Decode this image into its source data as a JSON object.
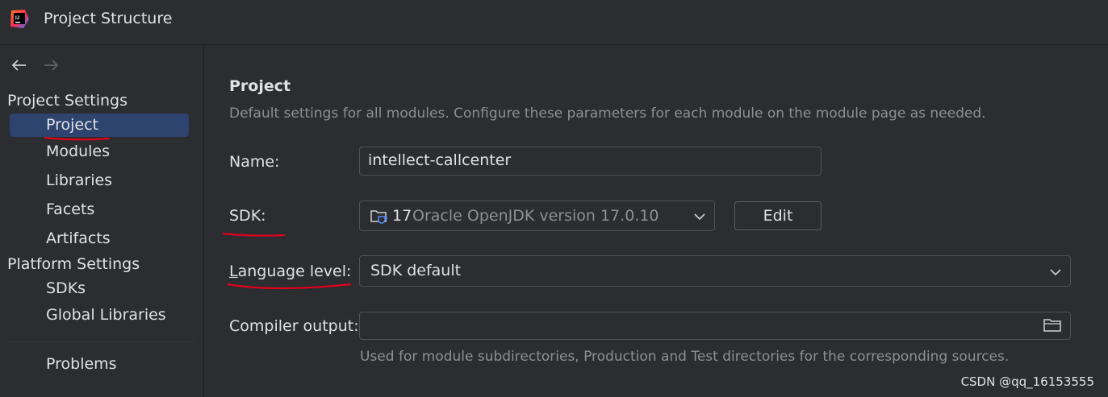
{
  "window": {
    "title": "Project Structure",
    "logo_icon": "intellij-idea-icon"
  },
  "nav": {
    "back_icon": "arrow-left-icon",
    "forward_icon": "arrow-right-icon"
  },
  "sidebar": {
    "project_settings_header": "Project Settings",
    "project_settings_items": [
      {
        "label": "Project",
        "selected": true
      },
      {
        "label": "Modules"
      },
      {
        "label": "Libraries"
      },
      {
        "label": "Facets"
      },
      {
        "label": "Artifacts"
      }
    ],
    "platform_settings_header": "Platform Settings",
    "platform_settings_items": [
      {
        "label": "SDKs"
      },
      {
        "label": "Global Libraries"
      }
    ],
    "problems_label": "Problems"
  },
  "main": {
    "heading": "Project",
    "description": "Default settings for all modules. Configure these parameters for each module on the module page as needed.",
    "name_label": "Name:",
    "name_value": "intellect-callcenter",
    "sdk_label": "SDK:",
    "sdk_version": "17",
    "sdk_detail": "Oracle OpenJDK version 17.0.10",
    "sdk_icon": "jdk-folder-icon",
    "edit_button": "Edit",
    "language_level_label_first": "L",
    "language_level_label_rest": "anguage level:",
    "language_level_value": "SDK default",
    "compiler_output_label": "Compiler output:",
    "compiler_output_value": "",
    "compiler_output_hint": "Used for module subdirectories, Production and Test directories for the corresponding sources."
  },
  "watermark": "CSDN @qq_16153555",
  "colors": {
    "background": "#2b2d30",
    "selection": "#2e436e",
    "annotation": "#e0001b",
    "muted_text": "#8c8f94"
  }
}
